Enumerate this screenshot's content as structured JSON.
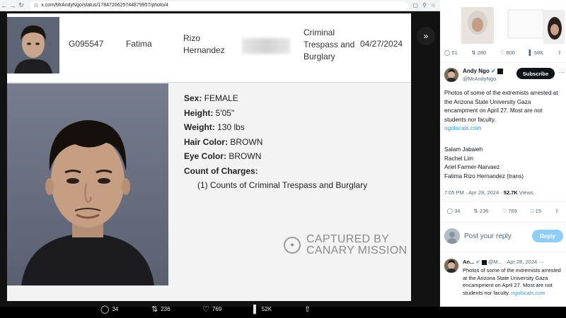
{
  "browser": {
    "url": "x.com/MrAndyNgo/status/1784720625744879957/photo/4"
  },
  "record": {
    "booking_id": "G095547",
    "first_name": "Fatima",
    "last_name": "Rizo Hernandez",
    "charge_summary": "Criminal Trespass and Burglary",
    "date": "04/27/2024"
  },
  "details": {
    "sex_label": "Sex:",
    "sex": "FEMALE",
    "height_label": "Height:",
    "height": "5'05\"",
    "weight_label": "Weight:",
    "weight": "130 lbs",
    "hair_label": "Hair Color:",
    "hair": "BROWN",
    "eye_label": "Eye Color:",
    "eye": "BROWN",
    "charges_label": "Count of Charges:",
    "charge_line": "(1) Counts of Criminal Trespass and Burglary"
  },
  "watermark": {
    "line1": "CAPTURED BY",
    "line2": "CANARY MISSION"
  },
  "photo_actions": {
    "replies": "34",
    "reposts": "236",
    "likes": "769",
    "views": "52K"
  },
  "sidebar": {
    "top_metrics": {
      "replies": "51",
      "reposts": "280",
      "likes": "800",
      "views": "58K"
    },
    "author": {
      "name": "Andy Ngo",
      "handle": "@MrAndyNgo",
      "subscribe": "Subscribe"
    },
    "tweet_text": "Photos of some of the extremists arrested at the Arizona State University Gaza encampment on April 27. Most are not students nor faculty.",
    "tweet_link": "ngolocals.com",
    "names": [
      "Salam Jabaieh",
      "Rachel Lim",
      "Ariel Farmer-Narvaez",
      "Fatima Rizo Hernandez (trans)"
    ],
    "meta": {
      "time": "7:05 PM · Apr 28, 2024 · ",
      "views": "52.7K",
      "views_label": " Views"
    },
    "actions": {
      "replies": "34",
      "reposts": "236",
      "likes": "769",
      "bookmarks": "15"
    },
    "reply_placeholder": "Post your reply",
    "reply_button": "Reply",
    "reply_item": {
      "name": "An...",
      "handle": "@M...",
      "date": "· Apr 28, 2024",
      "text": "Photos of some of the extremists arrested at the Arizona State University Gaza encampment on April 27. Most are not students nor faculty.",
      "link": "ngolocals.com"
    }
  },
  "colors": {
    "accent": "#1d9bf0",
    "reply_button": "#8ecdf8",
    "watermark": "#8a8a8a"
  }
}
